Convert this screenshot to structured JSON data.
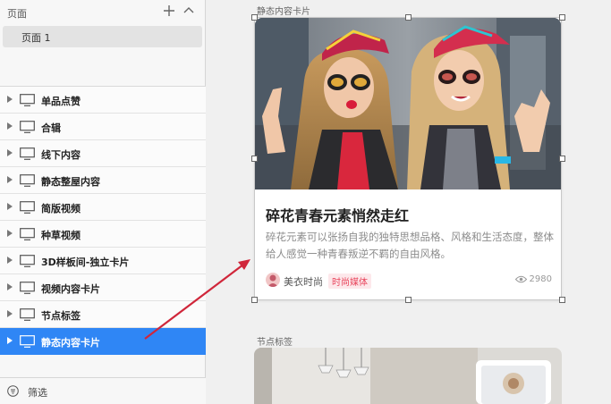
{
  "sidebar": {
    "pages_title": "页面",
    "pages": [
      {
        "label": "页面 1"
      }
    ],
    "layers": [
      {
        "label": "单品点赞"
      },
      {
        "label": "合辑"
      },
      {
        "label": "线下内容"
      },
      {
        "label": "静态整屋内容"
      },
      {
        "label": "简版视频"
      },
      {
        "label": "种草视频"
      },
      {
        "label": "3D样板间-独立卡片"
      },
      {
        "label": "视频内容卡片"
      },
      {
        "label": "节点标签"
      },
      {
        "label": "静态内容卡片",
        "selected": true
      }
    ],
    "filter_label": "筛选"
  },
  "canvas": {
    "artboards": [
      {
        "label": "静态内容卡片"
      },
      {
        "label": "节点标签"
      }
    ],
    "card": {
      "title": "碎花青春元素悄然走红",
      "description": "碎花元素可以张扬自我的独特思想品格、风格和生活态度，整体给人感觉一种青春叛逆不羁的自由风格。",
      "author": "美衣时尚",
      "author_tag": "时尚媒体",
      "views": "2980"
    }
  },
  "colors": {
    "accent": "#2f86f5",
    "annotation_arrow": "#d0263a",
    "tag_text": "#e8455c"
  }
}
